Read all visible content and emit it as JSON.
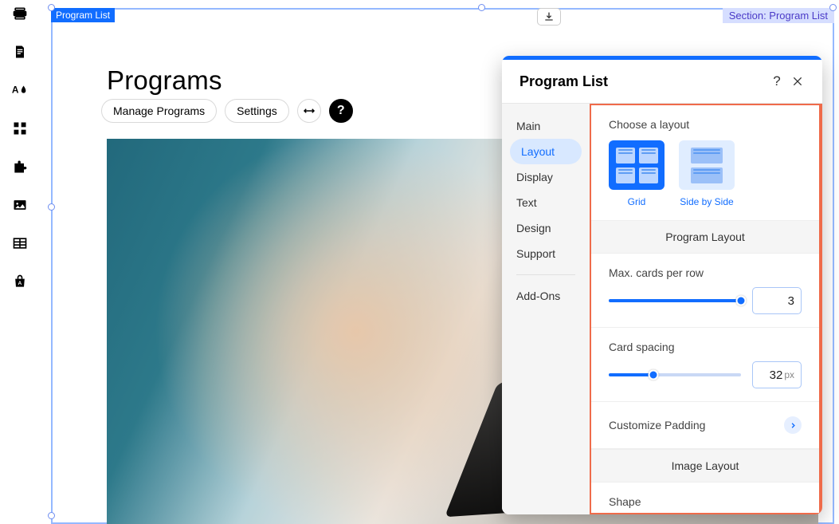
{
  "tags": {
    "programList": "Program List",
    "section": "Section: Program List"
  },
  "page": {
    "title": "Programs"
  },
  "toolbar": {
    "manage": "Manage Programs",
    "settings": "Settings",
    "helpGlyph": "?"
  },
  "panel": {
    "title": "Program List",
    "tabs": {
      "main": "Main",
      "layout": "Layout",
      "display": "Display",
      "text": "Text",
      "design": "Design",
      "support": "Support",
      "addons": "Add-Ons"
    },
    "layout": {
      "chooseLabel": "Choose a layout",
      "options": {
        "grid": "Grid",
        "sideBySide": "Side by Side"
      },
      "programLayoutHeader": "Program Layout",
      "maxCards": {
        "label": "Max. cards per row",
        "value": "3"
      },
      "spacing": {
        "label": "Card spacing",
        "value": "32",
        "unit": "px"
      },
      "customizePadding": "Customize Padding",
      "imageLayoutHeader": "Image Layout",
      "shapeLabel": "Shape"
    }
  }
}
